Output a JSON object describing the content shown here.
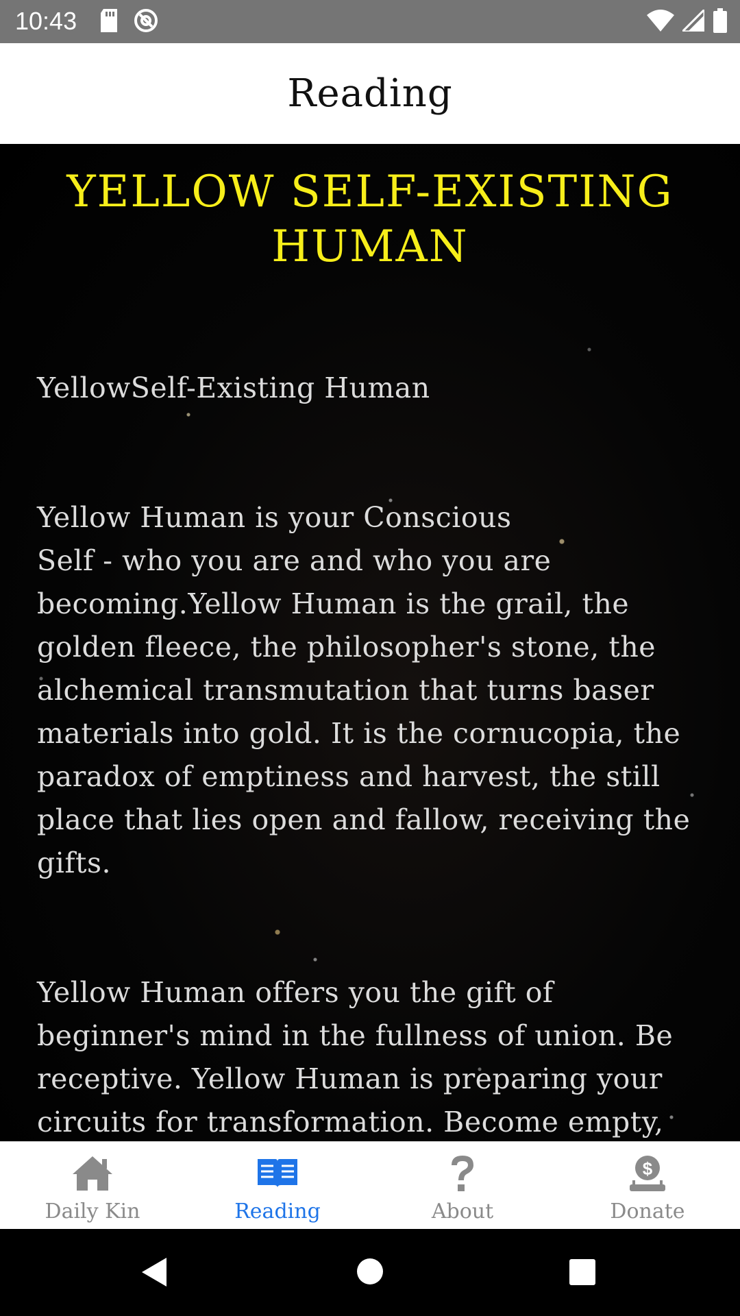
{
  "status_bar": {
    "time": "10:43",
    "left_icons": [
      "sd-card-icon",
      "do-not-disturb-icon"
    ],
    "right_icons": [
      "wifi-icon",
      "cell-signal-icon",
      "battery-icon"
    ]
  },
  "app_bar": {
    "title": "Reading"
  },
  "content": {
    "title": "YELLOW SELF-EXISTING HUMAN",
    "paragraphs": [
      "YellowSelf-Existing Human",
      "Yellow Human is your Conscious\nSelf - who you are and who you are becoming.Yellow Human is the grail, the golden fleece, the philosopher's stone, the alchemical transmutation that turns baser materials into gold. It is the cornucopia, the paradox of emptiness and harvest, the still place that lies open and fallow, receiving the gifts.",
      "Yellow Human offers you the gift of beginner's mind in the fullness of union. Be receptive. Yellow Human is preparing your circuits for transformation. Become empty, that your thirst may be quenched by the bounteous gifts poured from the chalice of the spiralling galaxies. Open"
    ]
  },
  "bottom_nav": {
    "items": [
      {
        "label": "Daily Kin",
        "icon": "home-icon",
        "active": false
      },
      {
        "label": "Reading",
        "icon": "book-open-icon",
        "active": true
      },
      {
        "label": "About",
        "icon": "question-mark-icon",
        "active": false
      },
      {
        "label": "Donate",
        "icon": "donate-icon",
        "active": false
      }
    ]
  },
  "colors": {
    "title": "#f7ee1a",
    "body_text": "#dcdcdc",
    "active_nav": "#1e74e8",
    "inactive_nav": "#8a8a8a",
    "status_bar": "#757575"
  }
}
